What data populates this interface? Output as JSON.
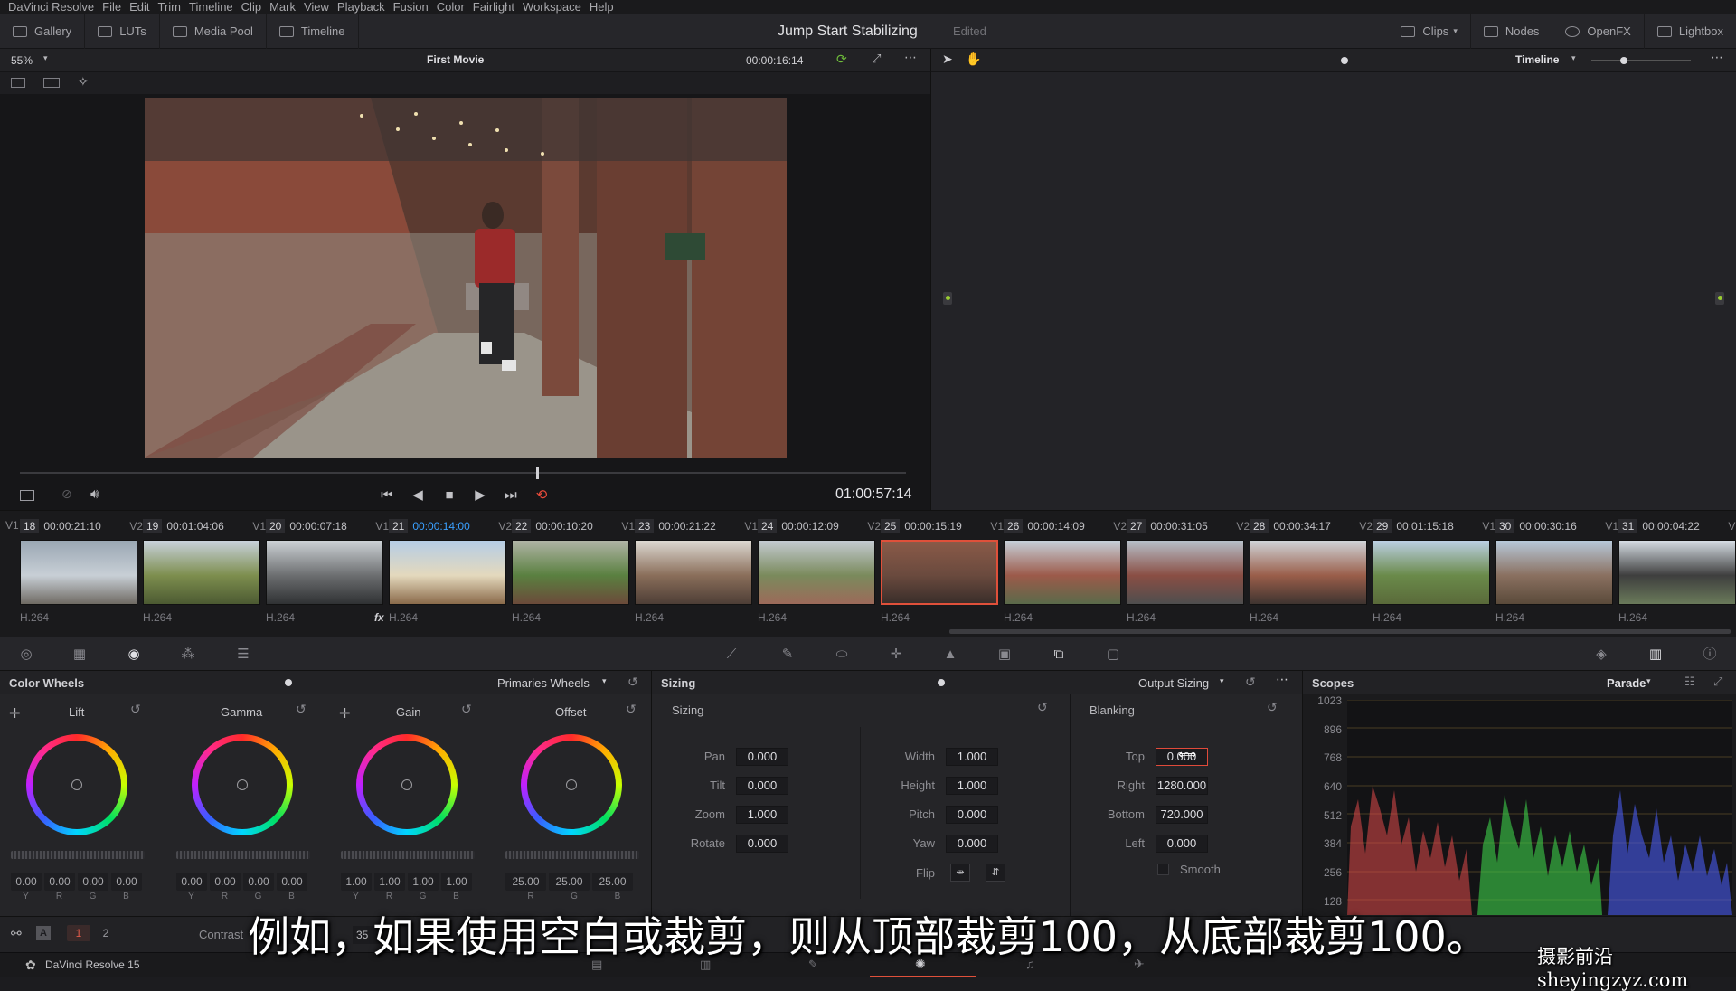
{
  "menu": [
    "DaVinci Resolve",
    "File",
    "Edit",
    "Trim",
    "Timeline",
    "Clip",
    "Mark",
    "View",
    "Playback",
    "Fusion",
    "Color",
    "Fairlight",
    "Workspace",
    "Help"
  ],
  "toolbar": {
    "left": [
      "Gallery",
      "LUTs",
      "Media Pool",
      "Timeline"
    ],
    "right": [
      "Clips",
      "Nodes",
      "OpenFX",
      "Lightbox"
    ]
  },
  "project": {
    "title": "Jump Start Stabilizing",
    "status": "Edited"
  },
  "viewer": {
    "zoom": "55%",
    "clip_name": "First Movie",
    "clip_timecode": "00:00:16:14",
    "timecode": "01:00:57:14"
  },
  "node_panel": {
    "mode": "Timeline"
  },
  "clips": [
    {
      "num": "18",
      "tc": "00:00:21:10",
      "track": "V2",
      "codec": "H.264",
      "colors": [
        "#9aa7b3",
        "#c8cfd6",
        "#6f6a63"
      ]
    },
    {
      "num": "19",
      "tc": "00:01:04:06",
      "track": "V1",
      "codec": "H.264",
      "colors": [
        "#c9d2dc",
        "#7d8e4e",
        "#4c5a32"
      ]
    },
    {
      "num": "20",
      "tc": "00:00:07:18",
      "track": "V1",
      "codec": "H.264",
      "colors": [
        "#cdd2d6",
        "#6c6e70",
        "#2f3133"
      ]
    },
    {
      "num": "21",
      "tc": "00:00:14:00",
      "track": "V2",
      "codec": "H.264",
      "fx": "fx",
      "colors": [
        "#b5cde6",
        "#e4d9bd",
        "#8a6a4a"
      ]
    },
    {
      "num": "22",
      "tc": "00:00:10:20",
      "track": "V1",
      "codec": "H.264",
      "colors": [
        "#b0b4a5",
        "#5a8040",
        "#6b4a3a"
      ]
    },
    {
      "num": "23",
      "tc": "00:00:21:22",
      "track": "V1",
      "codec": "H.264",
      "colors": [
        "#ddd9d2",
        "#8a6e5a",
        "#4d3e36"
      ]
    },
    {
      "num": "24",
      "tc": "00:00:12:09",
      "track": "V2",
      "codec": "H.264",
      "colors": [
        "#c4cbd1",
        "#7a8a5c",
        "#9c6a5a"
      ]
    },
    {
      "num": "25",
      "tc": "00:00:15:19",
      "track": "V1",
      "codec": "H.264",
      "colors": [
        "#8a5a48",
        "#6a4a3e",
        "#3a2e2a"
      ]
    },
    {
      "num": "26",
      "tc": "00:00:14:09",
      "track": "V2",
      "codec": "H.264",
      "colors": [
        "#c7d0d9",
        "#9c5a4a",
        "#5a6a4a"
      ]
    },
    {
      "num": "27",
      "tc": "00:00:31:05",
      "track": "V2",
      "codec": "H.264",
      "colors": [
        "#b7c0c9",
        "#8a4e44",
        "#4e4e4e"
      ]
    },
    {
      "num": "28",
      "tc": "00:00:34:17",
      "track": "V2",
      "codec": "H.264",
      "colors": [
        "#d0d4d8",
        "#9a5e4a",
        "#3e3430"
      ]
    },
    {
      "num": "29",
      "tc": "00:01:15:18",
      "track": "V1",
      "codec": "H.264",
      "colors": [
        "#bcd0e4",
        "#6a8a4a",
        "#5a6a3a"
      ]
    },
    {
      "num": "30",
      "tc": "00:00:30:16",
      "track": "V1",
      "codec": "H.264",
      "colors": [
        "#b8c9da",
        "#8a7060",
        "#5a4a3a"
      ]
    },
    {
      "num": "31",
      "tc": "00:00:04:22",
      "track": "V1",
      "codec": "H.264",
      "colors": [
        "#d6dde4",
        "#3e3e3e",
        "#6a7a5a"
      ]
    }
  ],
  "color_wheels": {
    "title": "Color Wheels",
    "mode": "Primaries Wheels",
    "wheels": [
      {
        "name": "Lift",
        "values": [
          "0.00",
          "0.00",
          "0.00",
          "0.00"
        ],
        "labels": [
          "Y",
          "R",
          "G",
          "B"
        ]
      },
      {
        "name": "Gamma",
        "values": [
          "0.00",
          "0.00",
          "0.00",
          "0.00"
        ],
        "labels": [
          "Y",
          "R",
          "G",
          "B"
        ]
      },
      {
        "name": "Gain",
        "values": [
          "1.00",
          "1.00",
          "1.00",
          "1.00"
        ],
        "labels": [
          "Y",
          "R",
          "G",
          "B"
        ]
      },
      {
        "name": "Offset",
        "values": [
          "25.00",
          "25.00",
          "25.00"
        ],
        "labels": [
          "R",
          "G",
          "B"
        ]
      }
    ],
    "footer": {
      "page_a": "A",
      "page_1": "1",
      "page_2": "2",
      "contrast_label": "Contrast",
      "contrast_value": "1.",
      "pivot_value": "35"
    }
  },
  "sizing": {
    "title": "Sizing",
    "mode": "Output Sizing",
    "section": "Sizing",
    "left_fields": [
      {
        "label": "Pan",
        "value": "0.000"
      },
      {
        "label": "Tilt",
        "value": "0.000"
      },
      {
        "label": "Zoom",
        "value": "1.000"
      },
      {
        "label": "Rotate",
        "value": "0.000"
      }
    ],
    "right_fields": [
      {
        "label": "Width",
        "value": "1.000"
      },
      {
        "label": "Height",
        "value": "1.000"
      },
      {
        "label": "Pitch",
        "value": "0.000"
      },
      {
        "label": "Yaw",
        "value": "0.000"
      }
    ],
    "flip_label": "Flip",
    "blanking": {
      "title": "Blanking",
      "fields": [
        {
          "label": "Top",
          "value": "0.000"
        },
        {
          "label": "Right",
          "value": "1280.000"
        },
        {
          "label": "Bottom",
          "value": "720.000"
        },
        {
          "label": "Left",
          "value": "0.000"
        }
      ],
      "smooth_label": "Smooth"
    }
  },
  "scopes": {
    "title": "Scopes",
    "mode": "Parade",
    "scale": [
      "1023",
      "896",
      "768",
      "640",
      "512",
      "384",
      "256",
      "128"
    ]
  },
  "footer": {
    "app": "DaVinci Resolve 15"
  },
  "subtitle": "例如，如果使用空白或裁剪，则从顶部裁剪100，从底部裁剪100。",
  "watermark": "摄影前沿 sheyingzyz.com"
}
